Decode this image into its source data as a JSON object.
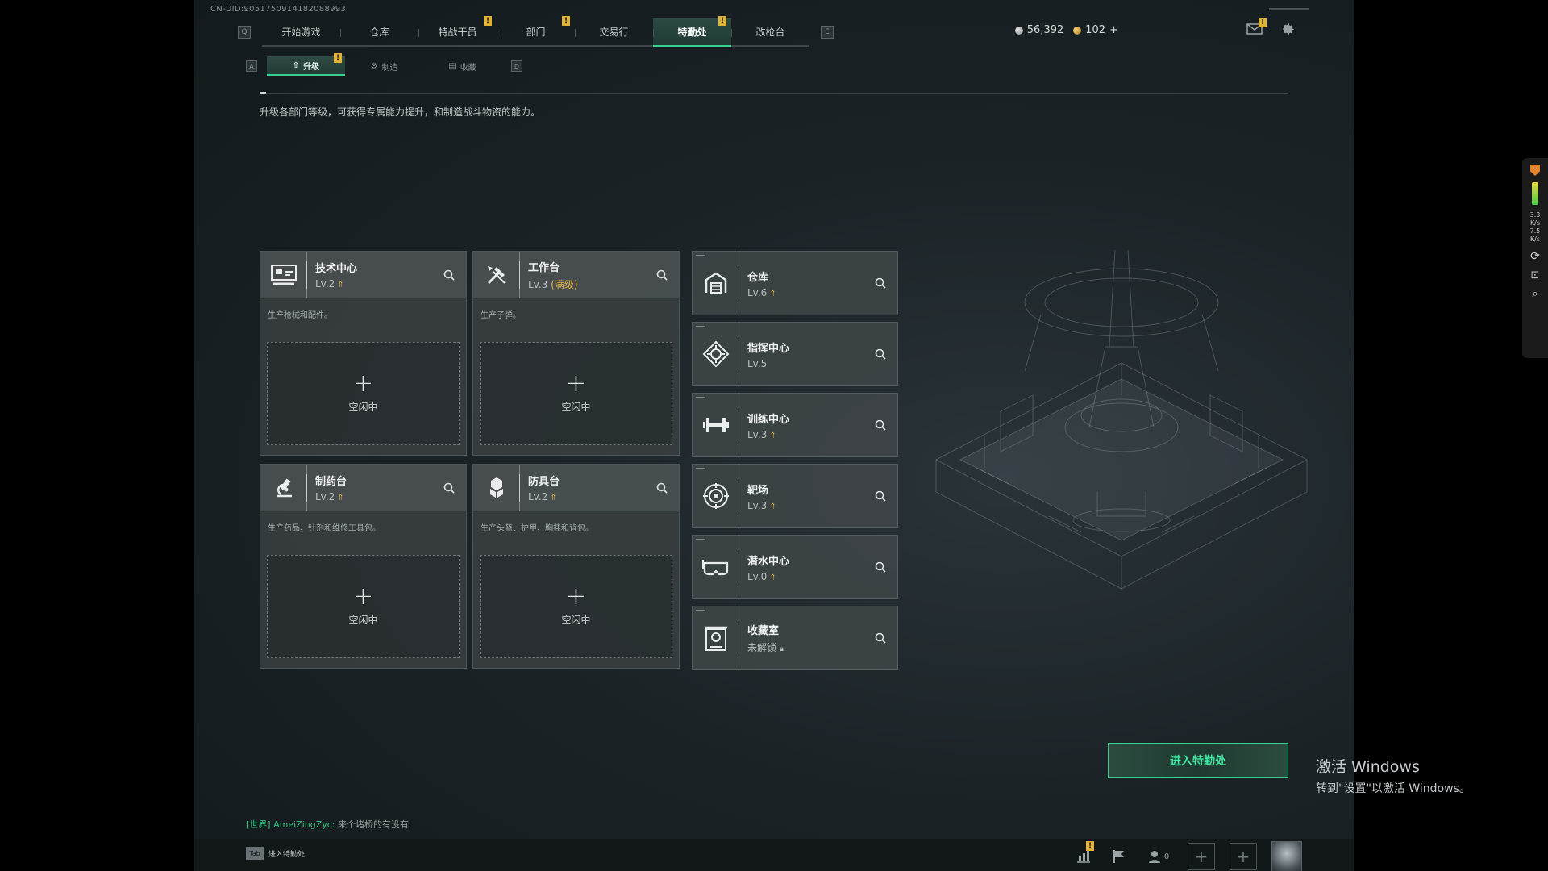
{
  "uid": "CN-UID:9051750914182088993",
  "nav": {
    "left_key": "Q",
    "right_key": "E",
    "tabs": [
      {
        "label": "开始游戏",
        "badge": ""
      },
      {
        "label": "仓库",
        "badge": ""
      },
      {
        "label": "特战干员",
        "badge": "!"
      },
      {
        "label": "部门",
        "badge": "!"
      },
      {
        "label": "交易行",
        "badge": ""
      },
      {
        "label": "特勤处",
        "badge": "!",
        "active": true
      },
      {
        "label": "改枪台",
        "badge": ""
      }
    ]
  },
  "currency": {
    "silver": "56,392",
    "gold": "102",
    "add": "+"
  },
  "topicons": {
    "mail_badge": "!"
  },
  "subnav": {
    "left_key": "A",
    "right_key": "D",
    "tabs": [
      {
        "label": "升级",
        "badge": "!",
        "active": true
      },
      {
        "label": "制造",
        "badge": ""
      },
      {
        "label": "收藏",
        "badge": ""
      }
    ]
  },
  "description": "升级各部门等级，可获得专属能力提升，和制造战斗物资的能力。",
  "facilities": [
    {
      "name": "技术中心",
      "level": "Lv.2",
      "desc": "生产枪械和配件。",
      "slot_status": "空闲中",
      "icon": "tech-center-icon"
    },
    {
      "name": "工作台",
      "level": "Lv.3",
      "max_tag": "(满级)",
      "desc": "生产子弹。",
      "slot_status": "空闲中",
      "icon": "workbench-icon"
    },
    {
      "name": "制药台",
      "level": "Lv.2",
      "desc": "生产药品、针剂和维修工具包。",
      "slot_status": "空闲中",
      "icon": "pharmacy-icon"
    },
    {
      "name": "防具台",
      "level": "Lv.2",
      "desc": "生产头盔、护甲、胸挂和背包。",
      "slot_status": "空闲中",
      "icon": "armor-bench-icon"
    }
  ],
  "departments": [
    {
      "name": "仓库",
      "level": "Lv.6",
      "upgrade": true,
      "icon": "warehouse-icon"
    },
    {
      "name": "指挥中心",
      "level": "Lv.5",
      "upgrade": false,
      "icon": "command-center-icon"
    },
    {
      "name": "训练中心",
      "level": "Lv.3",
      "upgrade": true,
      "icon": "training-center-icon"
    },
    {
      "name": "靶场",
      "level": "Lv.3",
      "upgrade": true,
      "icon": "shooting-range-icon"
    },
    {
      "name": "潜水中心",
      "level": "Lv.0",
      "upgrade": true,
      "icon": "diving-center-icon"
    },
    {
      "name": "收藏室",
      "level": "未解锁",
      "locked": true,
      "icon": "collection-room-icon"
    }
  ],
  "enter_button": "进入特勤处",
  "chat": {
    "channel": "[世界]",
    "user": "AmeiZingZyc:",
    "message": "来个堵桥的有没有"
  },
  "bottom": {
    "tab_key": "Tab",
    "tab_label": "进入特勤处",
    "stats_badge": "!",
    "friends_count": "0"
  },
  "watermark": {
    "line1": "激活 Windows",
    "line2": "转到\"设置\"以激活 Windows。"
  },
  "sidetool": {
    "upload": "3.3",
    "upload_unit": "K/s",
    "download": "7.5",
    "download_unit": "K/s"
  }
}
